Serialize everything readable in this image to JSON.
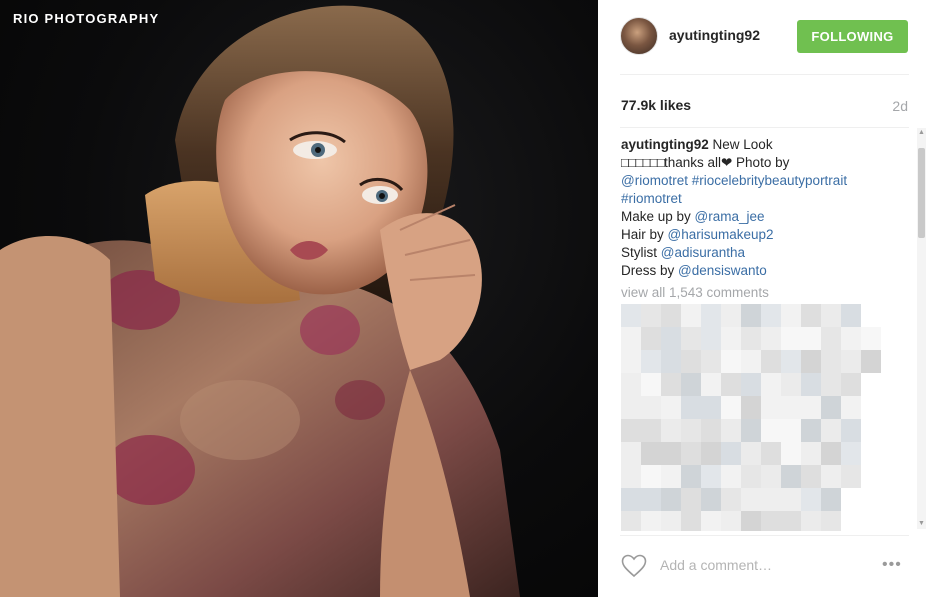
{
  "photo": {
    "watermark": "RIO PHOTOGRAPHY",
    "alt": "portrait photograph"
  },
  "post": {
    "username": "ayutingting92",
    "follow_label": "FOLLOWING",
    "follow_color": "#70c050",
    "likes": "77.9k likes",
    "time": "2d"
  },
  "caption": {
    "author": "ayutingting92",
    "line1": "New Look",
    "boxes": "□□□□□□",
    "thanks": "thanks all",
    "heart": "❤",
    "photo_by": " Photo by",
    "tag_riomotret": "@riomotret",
    "hashtag1": "#riocelebritybeautyportrait",
    "hashtag2": "#riomotret",
    "makeup_prefix": "Make up by ",
    "makeup_handle": "@rama_jee",
    "hair_prefix": "Hair by ",
    "hair_handle": "@harisumakeup2",
    "stylist_prefix": "Stylist ",
    "stylist_handle": "@adisurantha",
    "dress_prefix": "Dress by ",
    "dress_handle": "@densiswanto"
  },
  "comments": {
    "view_all": "view all 1,543 comments"
  },
  "footer": {
    "placeholder": "Add a comment…",
    "more": "•••"
  },
  "scrollbar": {
    "up": "▲",
    "down": "▼"
  },
  "colors": {
    "link": "#3b6ea5",
    "muted": "#a5a7aa",
    "text": "#262626"
  }
}
